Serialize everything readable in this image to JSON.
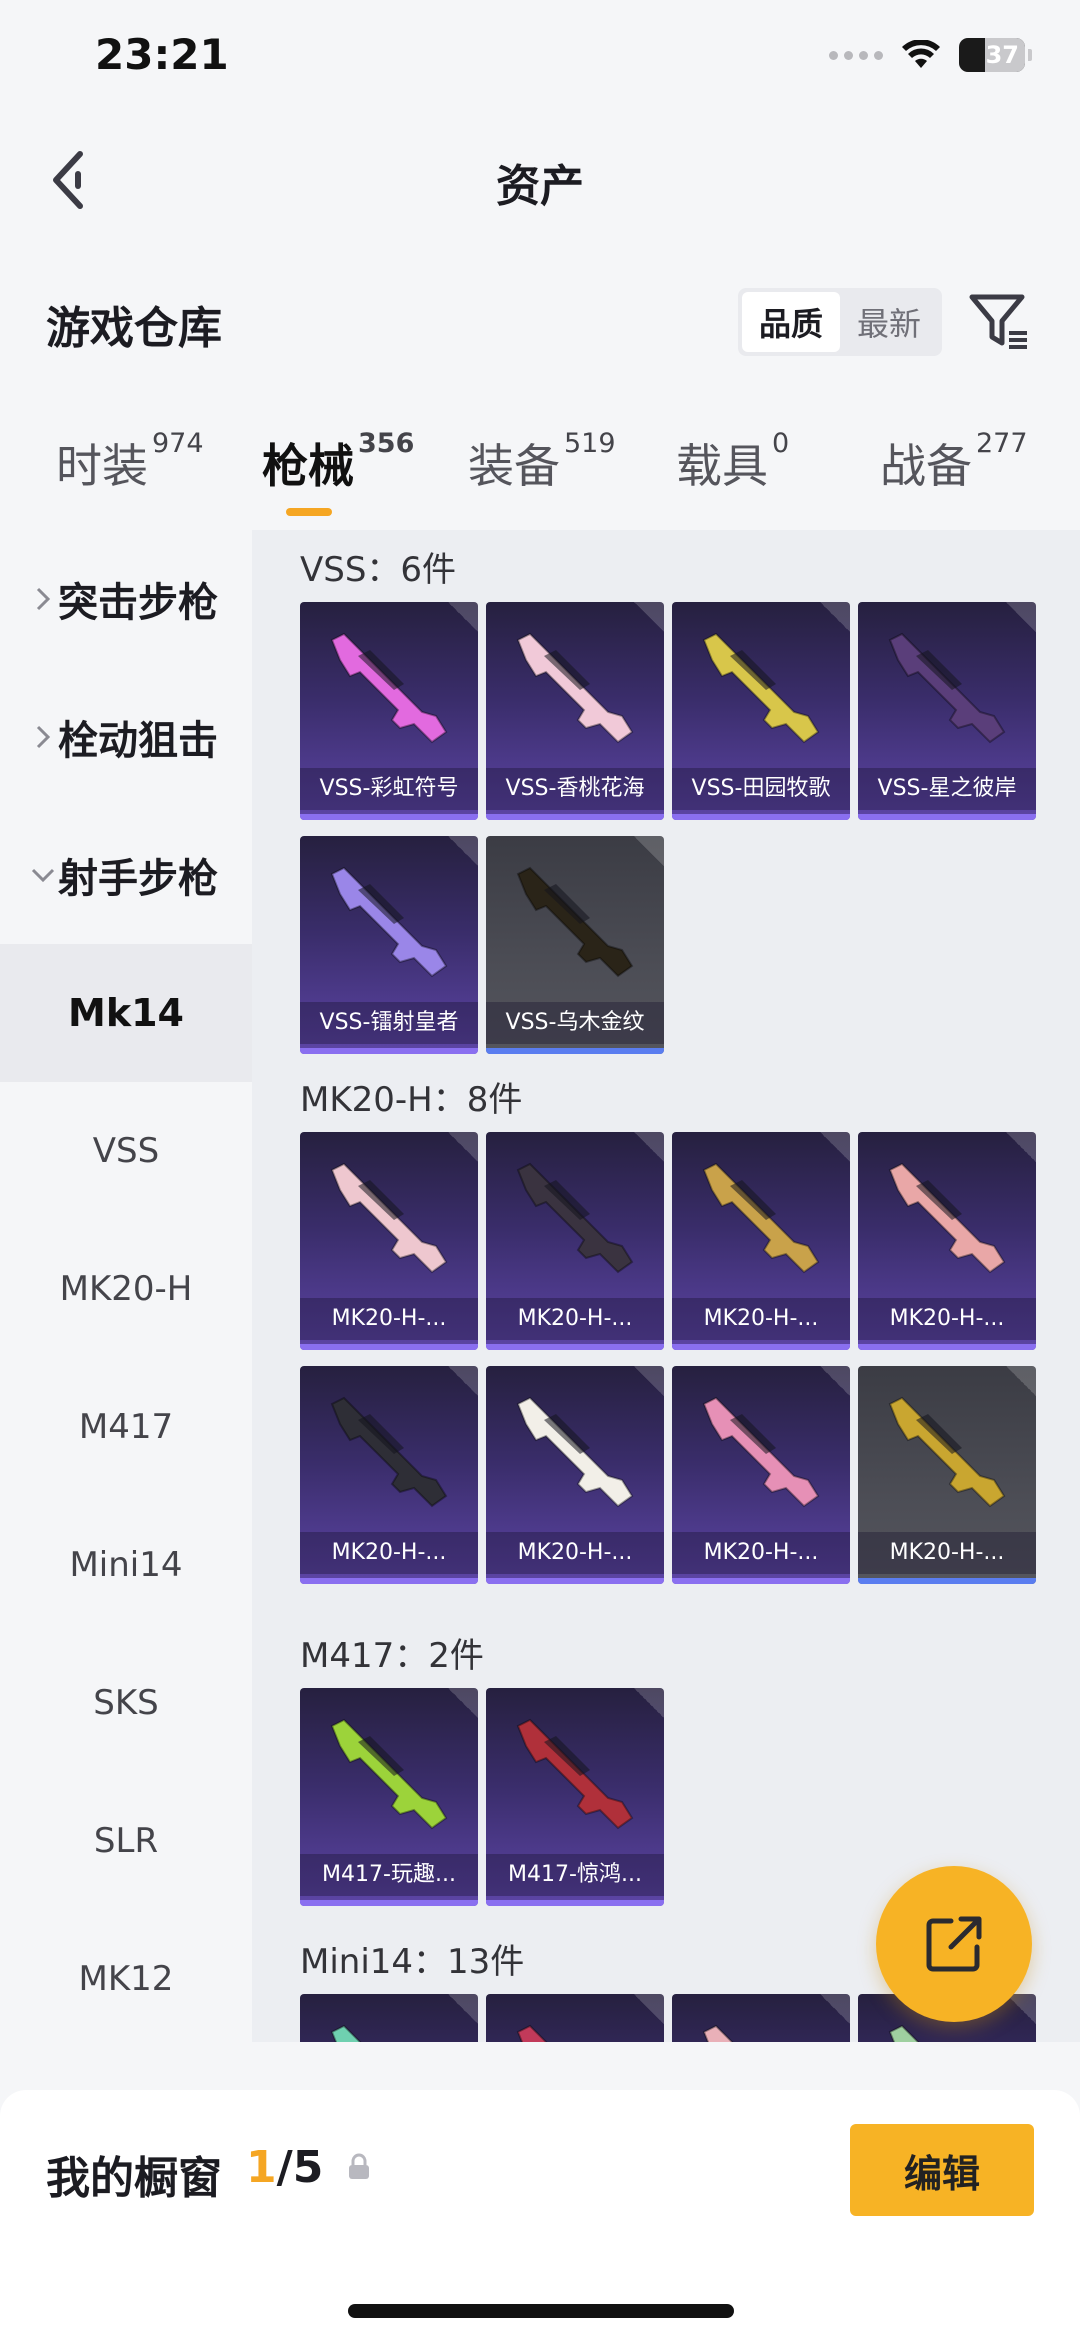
{
  "status": {
    "time": "23:21",
    "battery": "37"
  },
  "nav": {
    "title": "资产"
  },
  "warehouse": {
    "title": "游戏仓库",
    "sort_options": [
      "品质",
      "最新"
    ],
    "active_sort": "品质"
  },
  "tabs": [
    {
      "label": "时装",
      "count": "974"
    },
    {
      "label": "枪械",
      "count": "356"
    },
    {
      "label": "装备",
      "count": "519"
    },
    {
      "label": "载具",
      "count": "0"
    },
    {
      "label": "战备",
      "count": "277"
    }
  ],
  "active_tab": "枪械",
  "sidebar": {
    "categories": [
      {
        "label": "突击步枪",
        "expanded": false
      },
      {
        "label": "栓动狙击",
        "expanded": false
      },
      {
        "label": "射手步枪",
        "expanded": true
      }
    ],
    "items": [
      "Mk14",
      "VSS",
      "MK20-H",
      "M417",
      "Mini14",
      "SKS",
      "SLR",
      "MK12"
    ],
    "active_item": "Mk14"
  },
  "groups": [
    {
      "title": "VSS：6件",
      "items": [
        {
          "label": "VSS-彩虹符号",
          "theme": "purple",
          "gun_color": "#e26adf"
        },
        {
          "label": "VSS-香桃花海",
          "theme": "purple",
          "gun_color": "#f1c9d8"
        },
        {
          "label": "VSS-田园牧歌",
          "theme": "purple",
          "gun_color": "#d8c64a"
        },
        {
          "label": "VSS-星之彼岸",
          "theme": "purple",
          "gun_color": "#5a3e7a"
        },
        {
          "label": "VSS-镭射皇者",
          "theme": "purple",
          "gun_color": "#9a86e8"
        },
        {
          "label": "VSS-乌木金纹",
          "theme": "gray",
          "gun_color": "#2a2418"
        }
      ]
    },
    {
      "title": "MK20-H：8件",
      "items": [
        {
          "label": "MK20-H-...",
          "theme": "purple",
          "gun_color": "#eec7cf"
        },
        {
          "label": "MK20-H-...",
          "theme": "purple",
          "gun_color": "#3a3340"
        },
        {
          "label": "MK20-H-...",
          "theme": "purple",
          "gun_color": "#c9a24a"
        },
        {
          "label": "MK20-H-...",
          "theme": "purple",
          "gun_color": "#e9a7a7"
        },
        {
          "label": "MK20-H-...",
          "theme": "purple",
          "gun_color": "#2e2e36"
        },
        {
          "label": "MK20-H-...",
          "theme": "purple",
          "gun_color": "#f2efe8"
        },
        {
          "label": "MK20-H-...",
          "theme": "purple",
          "gun_color": "#e690b6"
        },
        {
          "label": "MK20-H-...",
          "theme": "gray",
          "gun_color": "#c9a630"
        }
      ]
    },
    {
      "title": "M417：2件",
      "items": [
        {
          "label": "M417-玩趣...",
          "theme": "purple",
          "gun_color": "#9cd33a"
        },
        {
          "label": "M417-惊鸿...",
          "theme": "purple",
          "gun_color": "#b0303a"
        }
      ]
    },
    {
      "title": "Mini14：13件",
      "items": [
        {
          "label": "",
          "theme": "purple",
          "gun_color": "#6fd0b0"
        },
        {
          "label": "",
          "theme": "purple",
          "gun_color": "#c23a5a"
        },
        {
          "label": "",
          "theme": "purple",
          "gun_color": "#e9b0b8"
        },
        {
          "label": "",
          "theme": "purple",
          "gun_color": "#9fd0a0"
        }
      ]
    }
  ],
  "showcase": {
    "label": "我的橱窗",
    "current": "1",
    "total": "/5",
    "edit_label": "编辑"
  },
  "colors": {
    "accent": "#f7b325",
    "card_purple": "#3a2d6b",
    "card_gray": "#4c4d55"
  }
}
